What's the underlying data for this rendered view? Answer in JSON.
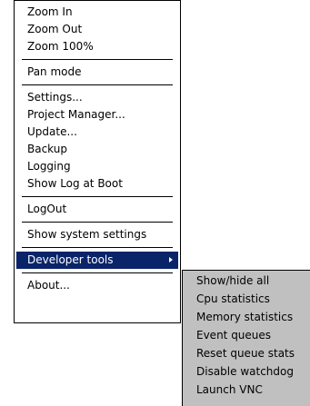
{
  "main_menu": {
    "zoom_in": "Zoom In",
    "zoom_out": "Zoom Out",
    "zoom_100": "Zoom 100%",
    "pan_mode": "Pan mode",
    "settings": "Settings...",
    "project_manager": "Project Manager...",
    "update": "Update...",
    "backup": "Backup",
    "logging": "Logging",
    "show_log_at_boot": "Show Log at Boot",
    "logout": "LogOut",
    "show_system_settings": "Show system settings",
    "developer_tools": "Developer tools",
    "about": "About..."
  },
  "developer_tools_menu": {
    "show_hide_all": "Show/hide all",
    "cpu_statistics": "Cpu statistics",
    "memory_statistics": "Memory statistics",
    "event_queues": "Event queues",
    "reset_queue_stats": "Reset queue stats",
    "disable_watchdog": "Disable watchdog",
    "launch_vnc": "Launch VNC"
  },
  "icons": {
    "submenu_arrow": "chevron-right-icon"
  },
  "colors": {
    "selection_background": "#0a246a",
    "selection_text": "#ffffff",
    "submenu_background": "#c0c0c0",
    "menu_background": "#ffffff"
  }
}
